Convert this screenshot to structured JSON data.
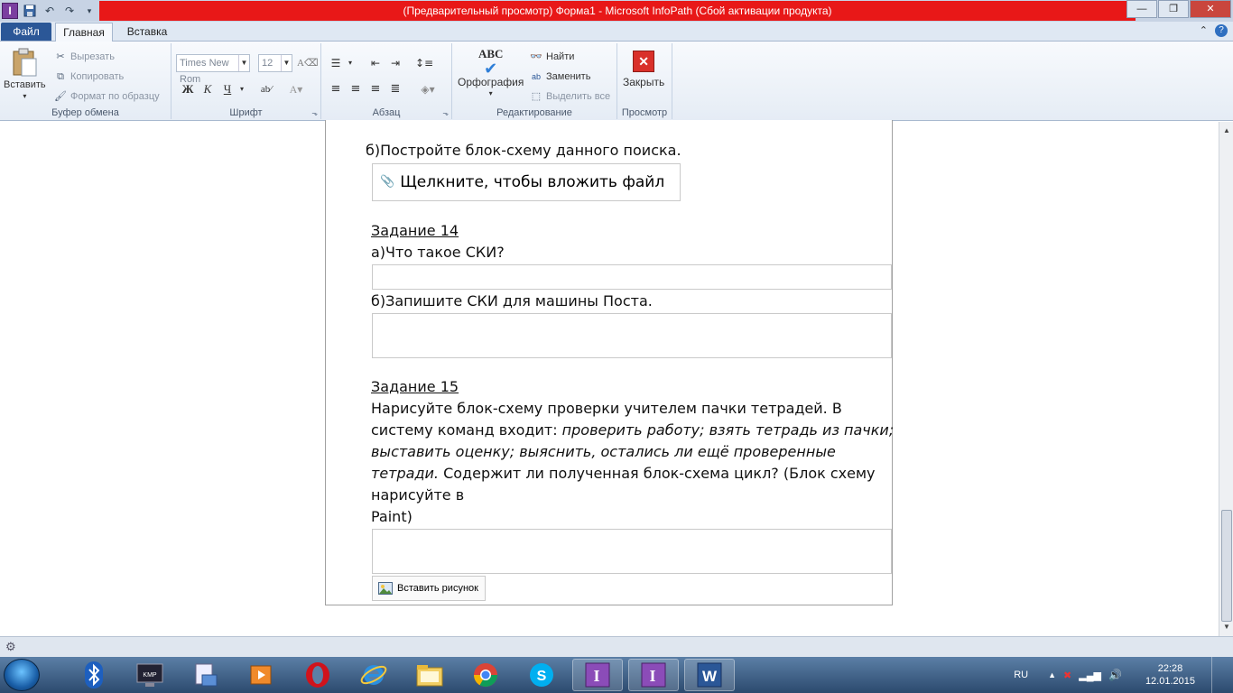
{
  "window": {
    "title": "(Предварительный просмотр) Форма1  -  Microsoft InfoPath (Сбой активации продукта)",
    "app_icon_letter": "I",
    "controls": [
      "—",
      "❐",
      "✕"
    ]
  },
  "tabs": {
    "file": "Файл",
    "home": "Главная",
    "insert": "Вставка"
  },
  "ribbon": {
    "clipboard": {
      "label": "Буфер обмена",
      "paste": "Вставить",
      "cut": "Вырезать",
      "copy": "Копировать",
      "format_painter": "Формат по образцу"
    },
    "font": {
      "label": "Шрифт",
      "font_name": "Times New Rom",
      "font_size": "12",
      "bold": "Ж",
      "italic": "К",
      "underline": "Ч"
    },
    "paragraph": {
      "label": "Абзац"
    },
    "editing": {
      "label": "Редактирование",
      "spelling": "Орфография",
      "spelling_icon_text": "ABC",
      "find": "Найти",
      "replace": "Заменить",
      "select_all": "Выделить все"
    },
    "preview": {
      "label": "Просмотр",
      "close": "Закрыть"
    }
  },
  "document": {
    "q13b": "б)Постройте блок-схему данного поиска.",
    "attach_label": "Щелкните, чтобы вложить файл",
    "task14_title": "Задание 14",
    "q14a": "а)Что такое СКИ?",
    "q14b": "б)Запишите СКИ для машины Поста.",
    "task15_title": "Задание 15",
    "task15_line1": "Нарисуйте блок-схему проверки учителем пачки тетрадей. В",
    "task15_line2_normal": "систему команд входит: ",
    "task15_line2_italic": "проверить работу; взять тетрадь из пачки;",
    "task15_line3_italic": "выставить оценку; выяснить, остались ли ещё проверенные",
    "task15_line4_italic": "тетради.",
    "task15_line4_normal": " Содержит ли полученная блок-схема цикл? (Блок схему",
    "task15_line5": "нарисуйте в",
    "task15_line6": "Paint)",
    "insert_picture": "Вставить рисунок"
  },
  "taskbar": {
    "language": "RU",
    "time": "22:28",
    "date": "12.01.2015"
  }
}
